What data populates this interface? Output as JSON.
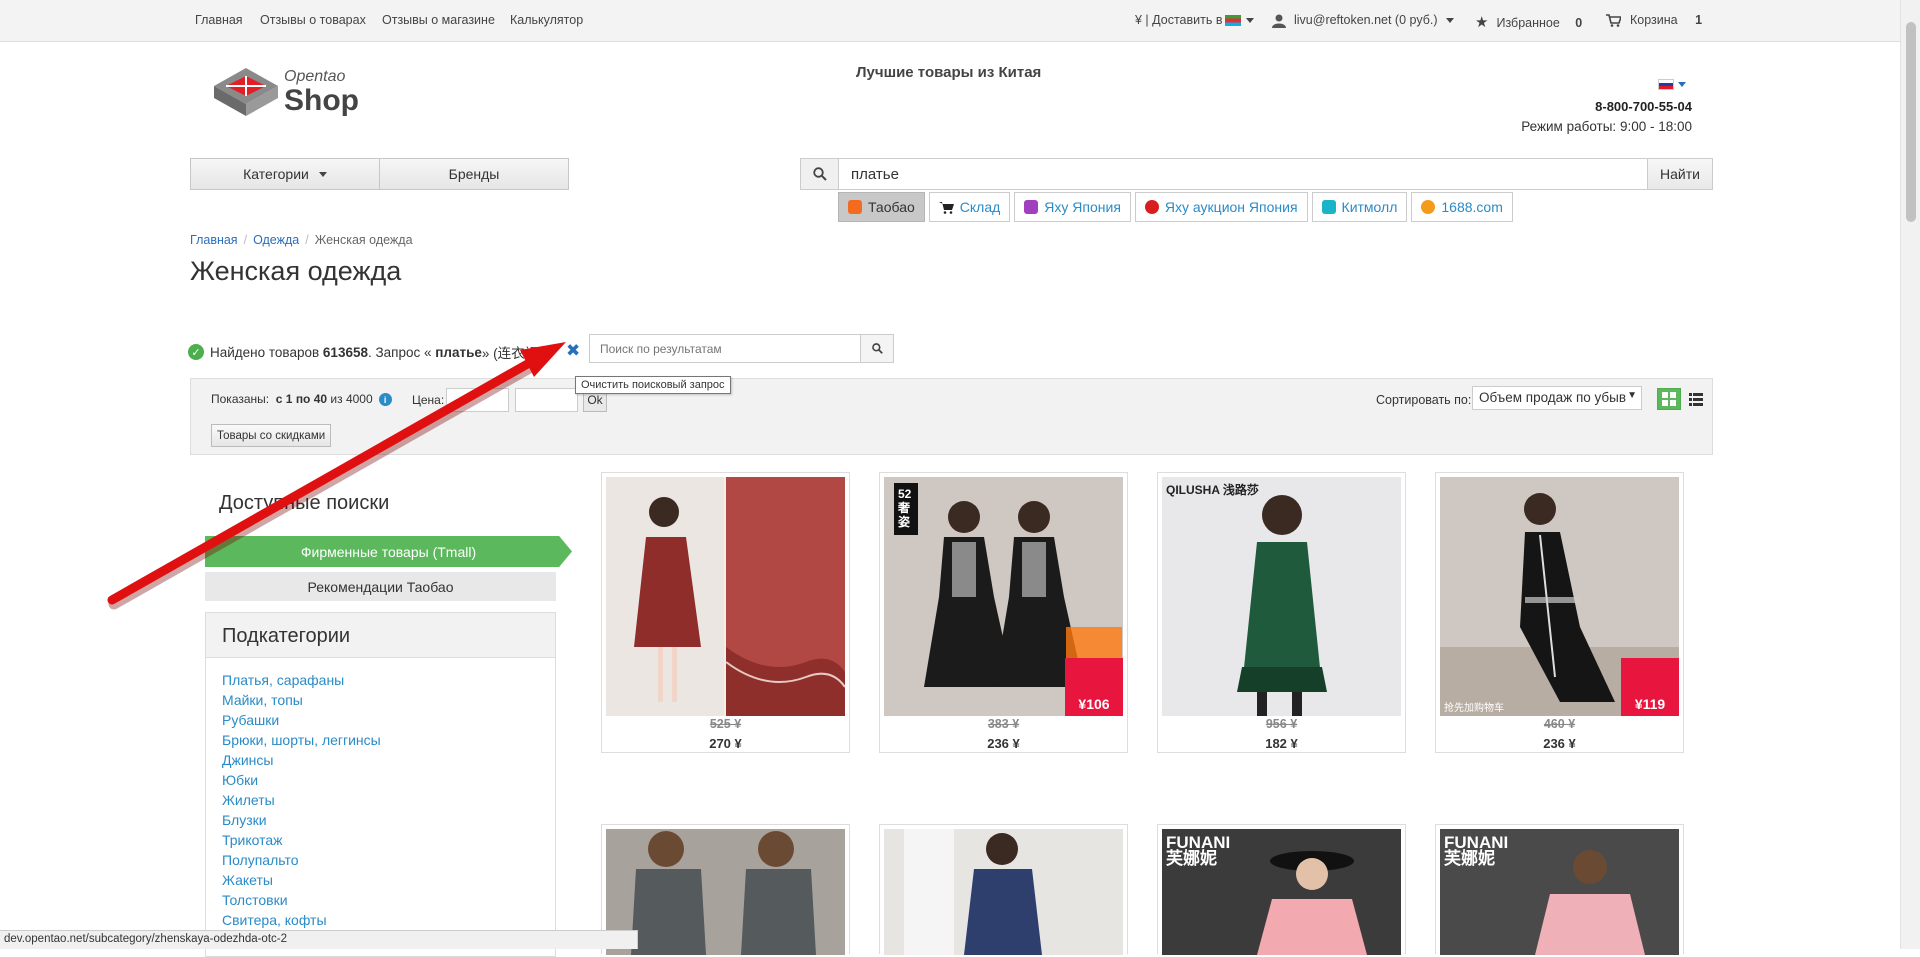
{
  "topnav": {
    "links": [
      "Главная",
      "Отзывы о товарах",
      "Отзывы о магазине",
      "Калькулятор"
    ],
    "delivery": "¥ | Доставить в",
    "user": "livu@reftoken.net (0 руб.)",
    "favorites_label": "Избранное",
    "favorites_count": "0",
    "cart_label": "Корзина",
    "cart_count": "1"
  },
  "header": {
    "logo_small": "Opentao",
    "logo_big": "Shop",
    "tagline": "Лучшие товары из Китая",
    "phone": "8-800-700-55-04",
    "hours": "Режим работы: 9:00 - 18:00"
  },
  "catbar": {
    "categories": "Категории",
    "brands": "Бренды"
  },
  "search": {
    "value": "платье",
    "button": "Найти"
  },
  "providers": [
    {
      "label": "Таобао",
      "color": "#f26b21"
    },
    {
      "label": "Склад",
      "color": "#222222"
    },
    {
      "label": "Яху Япония",
      "color": "#a23fbf"
    },
    {
      "label": "Яху аукцион Япония",
      "color": "#d81e1e"
    },
    {
      "label": "Китмолл",
      "color": "#1bb3c8"
    },
    {
      "label": "1688.com",
      "color": "#f59b1c"
    }
  ],
  "breadcrumb": {
    "home": "Главная",
    "clothes": "Одежда",
    "current": "Женская одежда"
  },
  "title": "Женская одежда",
  "found": {
    "prefix": "Найдено товаров",
    "count": "613658",
    "mid": ". Запрос «",
    "query": "платье",
    "suffix": "» (连衣裙) ."
  },
  "tooltip": "Очистить поисковый запрос",
  "result_search": {
    "placeholder": "Поиск по результатам"
  },
  "filters": {
    "shown_label": "Показаны:",
    "shown_range": "с 1 по 40",
    "shown_total": "из 4000",
    "price_label": "Цена:",
    "ok": "Ok",
    "discount_button": "Товары со скидками",
    "sort_label": "Сортировать по:",
    "sort_value": "Объем продаж по убыв"
  },
  "sidebar": {
    "available_title": "Доступные поиски",
    "tmall": "Фирменные товары (Tmall)",
    "recommend": "Рекомендации Таобао",
    "subcat_title": "Подкатегории",
    "subcategories": [
      "Платья, сарафаны",
      "Майки, топы",
      "Рубашки",
      "Брюки, шорты, леггинсы",
      "Джинсы",
      "Юбки",
      "Жилеты",
      "Блузки",
      "Трикотаж",
      "Полупальто",
      "Жакеты",
      "Толстовки",
      "Свитера, кофты"
    ]
  },
  "products": [
    {
      "old_price": "525 ¥",
      "price": "270 ¥"
    },
    {
      "old_price": "383 ¥",
      "price": "236 ¥",
      "image_text": "52 奢姿",
      "badge": "¥106"
    },
    {
      "old_price": "956 ¥",
      "price": "182 ¥",
      "image_text": "QILUSHA 浅路莎"
    },
    {
      "old_price": "460 ¥",
      "price": "236 ¥",
      "image_text": "抢先加购物车",
      "badge": "¥119"
    }
  ],
  "products_row2": [
    {
      "image_text": ""
    },
    {
      "image_text": ""
    },
    {
      "image_text": "FUNANI 芙娜妮"
    },
    {
      "image_text": "FUNANI 芙娜妮"
    }
  ],
  "statusbar": "dev.opentao.net/subcategory/zhenskaya-odezhda-otc-2"
}
